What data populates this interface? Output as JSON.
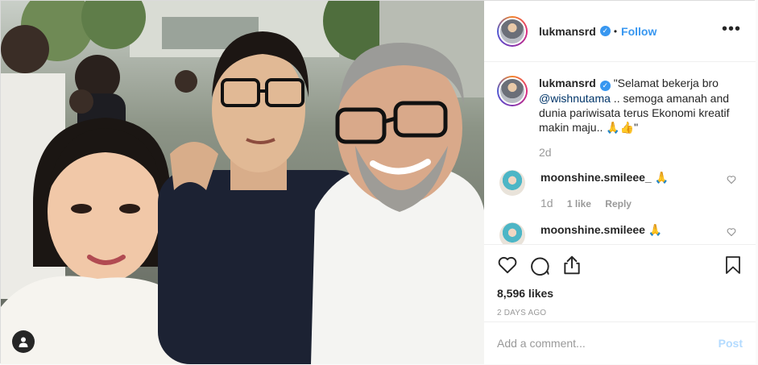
{
  "post": {
    "username": "lukmansrd",
    "verified_badge": "verified-check-icon",
    "separator": "•",
    "follow_label": "Follow",
    "more_icon": "more-options-icon"
  },
  "caption": {
    "username": "lukmansrd",
    "text_before": "\"Selamat bekerja bro ",
    "mention": "@wishnutama",
    "text_after": " .. semoga amanah and dunia pariwisata terus Ekonomi kreatif makin maju.. 🙏👍\"",
    "time": "2d"
  },
  "comments": [
    {
      "username": "moonshine.smileee_",
      "text": "🙏",
      "time": "1d",
      "likes": "1 like",
      "reply": "Reply"
    },
    {
      "username": "moonshine.smileee",
      "text": "🙏",
      "time": "",
      "likes": "",
      "reply": ""
    }
  ],
  "actions": {
    "like_icon": "heart-icon",
    "comment_icon": "comment-icon",
    "share_icon": "share-icon",
    "save_icon": "bookmark-icon",
    "likes_count": "8,596 likes",
    "posted": "2 DAYS AGO"
  },
  "add_comment": {
    "placeholder": "Add a comment...",
    "post_label": "Post"
  },
  "colors": {
    "accent": "#3897f0",
    "text": "#262626",
    "muted": "#999999",
    "border": "#dbdbdb",
    "post_disabled": "#b3dbff"
  }
}
